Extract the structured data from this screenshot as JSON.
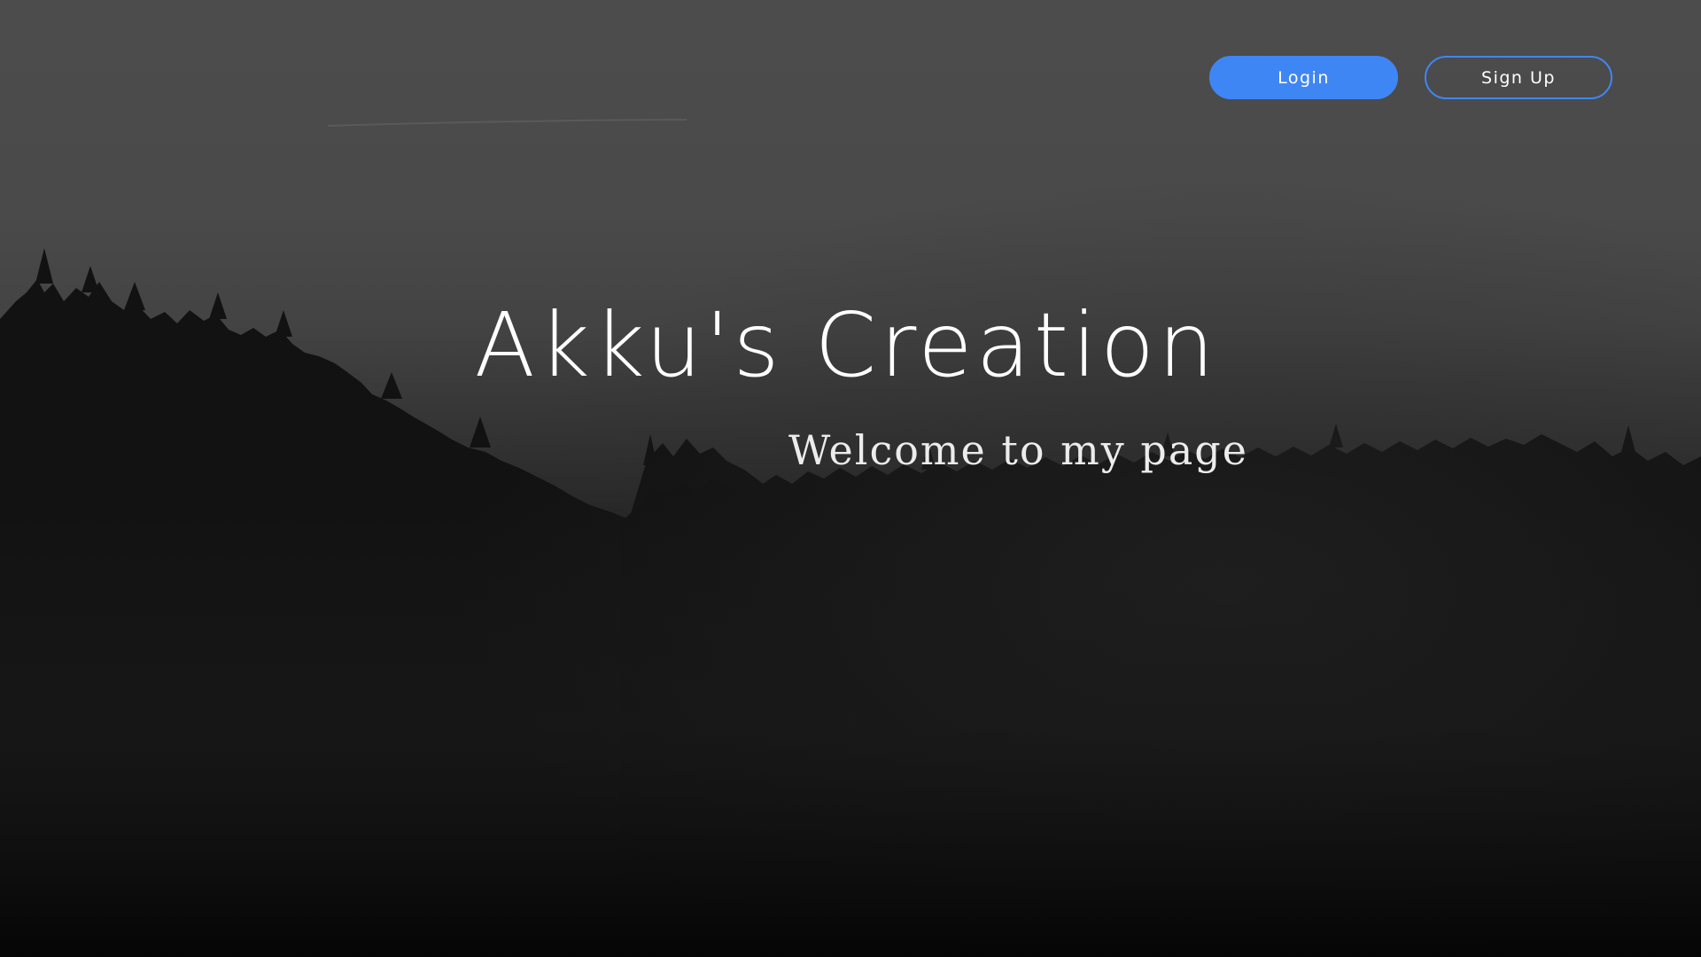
{
  "header": {
    "login_label": "Login",
    "signup_label": "Sign Up"
  },
  "hero": {
    "title": "Akku's Creation",
    "subtitle": "Welcome to my page"
  },
  "colors": {
    "accent": "#3f86f5",
    "text": "#ffffff",
    "sky": "#4c4c4c",
    "forest": "#070707"
  }
}
